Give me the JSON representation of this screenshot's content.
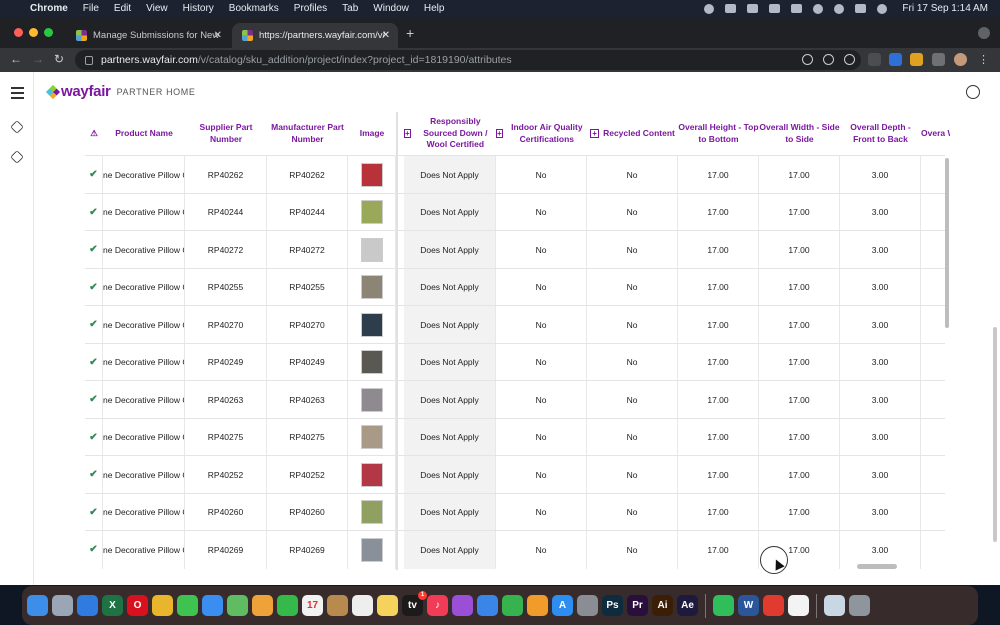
{
  "menubar": {
    "app": "Chrome",
    "items": [
      "File",
      "Edit",
      "View",
      "History",
      "Bookmarks",
      "Profiles",
      "Tab",
      "Window",
      "Help"
    ],
    "clock": "Fri 17 Sep  1:14 AM"
  },
  "browser": {
    "tabs": [
      {
        "title": "Manage Submissions for New"
      },
      {
        "title": "https://partners.wayfair.com/v/"
      }
    ],
    "url_host": "partners.wayfair.com",
    "url_path": "/v/catalog/sku_addition/project/index?project_id=1819190/attributes"
  },
  "app": {
    "brand": "wayfair",
    "brand_sub": "PARTNER HOME",
    "brand_color": "#7b189f"
  },
  "table": {
    "headers": {
      "status": "⚠",
      "product_name": "Product Name",
      "supplier_part": "Supplier Part Number",
      "manufacturer_part": "Manufacturer Part Number",
      "image": "Image",
      "responsibly_sourced": "Responsibly Sourced Down / Wool Certified",
      "indoor_air": "Indoor Air Quality Certifications",
      "recycled": "Recycled Content",
      "height": "Overall Height - Top to Bottom",
      "width": "Overall Width - Side to Side",
      "depth": "Overall Depth - Front to Back",
      "overall_cut": "Overa W"
    },
    "rows": [
      {
        "name": "ne Decorative Pillow C",
        "supplier": "RP40262",
        "manufacturer": "RP40262",
        "img": "#b8323a",
        "resp": "Does Not Apply",
        "air": "No",
        "recycled": "No",
        "height": "17.00",
        "width": "17.00",
        "depth": "3.00"
      },
      {
        "name": "ne Decorative Pillow C",
        "supplier": "RP40244",
        "manufacturer": "RP40244",
        "img": "#9aa85a",
        "resp": "Does Not Apply",
        "air": "No",
        "recycled": "No",
        "height": "17.00",
        "width": "17.00",
        "depth": "3.00"
      },
      {
        "name": "ne Decorative Pillow C",
        "supplier": "RP40272",
        "manufacturer": "RP40272",
        "img": "#c9c9c9",
        "resp": "Does Not Apply",
        "air": "No",
        "recycled": "No",
        "height": "17.00",
        "width": "17.00",
        "depth": "3.00"
      },
      {
        "name": "ne Decorative Pillow C",
        "supplier": "RP40255",
        "manufacturer": "RP40255",
        "img": "#8c8474",
        "resp": "Does Not Apply",
        "air": "No",
        "recycled": "No",
        "height": "17.00",
        "width": "17.00",
        "depth": "3.00"
      },
      {
        "name": "ne Decorative Pillow C",
        "supplier": "RP40270",
        "manufacturer": "RP40270",
        "img": "#2d3d4b",
        "resp": "Does Not Apply",
        "air": "No",
        "recycled": "No",
        "height": "17.00",
        "width": "17.00",
        "depth": "3.00"
      },
      {
        "name": "ne Decorative Pillow C",
        "supplier": "RP40249",
        "manufacturer": "RP40249",
        "img": "#5a5852",
        "resp": "Does Not Apply",
        "air": "No",
        "recycled": "No",
        "height": "17.00",
        "width": "17.00",
        "depth": "3.00"
      },
      {
        "name": "ne Decorative Pillow C",
        "supplier": "RP40263",
        "manufacturer": "RP40263",
        "img": "#8e8a8f",
        "resp": "Does Not Apply",
        "air": "No",
        "recycled": "No",
        "height": "17.00",
        "width": "17.00",
        "depth": "3.00"
      },
      {
        "name": "ne Decorative Pillow C",
        "supplier": "RP40275",
        "manufacturer": "RP40275",
        "img": "#a89a86",
        "resp": "Does Not Apply",
        "air": "No",
        "recycled": "No",
        "height": "17.00",
        "width": "17.00",
        "depth": "3.00"
      },
      {
        "name": "ne Decorative Pillow C",
        "supplier": "RP40252",
        "manufacturer": "RP40252",
        "img": "#b23845",
        "resp": "Does Not Apply",
        "air": "No",
        "recycled": "No",
        "height": "17.00",
        "width": "17.00",
        "depth": "3.00"
      },
      {
        "name": "ne Decorative Pillow C",
        "supplier": "RP40260",
        "manufacturer": "RP40260",
        "img": "#8fa060",
        "resp": "Does Not Apply",
        "air": "No",
        "recycled": "No",
        "height": "17.00",
        "width": "17.00",
        "depth": "3.00"
      },
      {
        "name": "ne Decorative Pillow C",
        "supplier": "RP40269",
        "manufacturer": "RP40269",
        "img": "#8a9099",
        "resp": "Does Not Apply",
        "air": "No",
        "recycled": "No",
        "height": "17.00",
        "width": "17.00",
        "depth": "3.00"
      }
    ]
  },
  "dock": {
    "apps": [
      {
        "name": "finder",
        "color": "#3d8ee8",
        "label": ""
      },
      {
        "name": "launchpad",
        "color": "#9aa5b5",
        "label": ""
      },
      {
        "name": "safari",
        "color": "#2f7be0",
        "label": ""
      },
      {
        "name": "excel",
        "color": "#1f7244",
        "label": "X"
      },
      {
        "name": "opera",
        "color": "#d9101d",
        "label": "O"
      },
      {
        "name": "chrome",
        "color": "#e9b52c",
        "label": ""
      },
      {
        "name": "messages",
        "color": "#3fc350",
        "label": ""
      },
      {
        "name": "mail",
        "color": "#3a8ef0",
        "label": ""
      },
      {
        "name": "maps",
        "color": "#5fbc61",
        "label": ""
      },
      {
        "name": "photos",
        "color": "#f0a23a",
        "label": ""
      },
      {
        "name": "facetime",
        "color": "#35b94a",
        "label": ""
      },
      {
        "name": "calendar",
        "color": "#f2f2f2",
        "label": "17"
      },
      {
        "name": "notes-brown",
        "color": "#b88a4e",
        "label": ""
      },
      {
        "name": "reminders",
        "color": "#eeeeee",
        "label": ""
      },
      {
        "name": "notes",
        "color": "#f5d25b",
        "label": ""
      },
      {
        "name": "tv",
        "color": "#1b1b1b",
        "label": "tv",
        "badge": "1"
      },
      {
        "name": "music",
        "color": "#f23c57",
        "label": "♪"
      },
      {
        "name": "podcasts",
        "color": "#9a4fd6",
        "label": ""
      },
      {
        "name": "keynote",
        "color": "#3a86e8",
        "label": ""
      },
      {
        "name": "numbers",
        "color": "#36b34e",
        "label": ""
      },
      {
        "name": "pages",
        "color": "#f09b2a",
        "label": ""
      },
      {
        "name": "app-store",
        "color": "#2d8ef0",
        "label": "A"
      },
      {
        "name": "system-preferences",
        "color": "#8a8d93",
        "label": ""
      },
      {
        "name": "photoshop",
        "color": "#0e2c3d",
        "label": "Ps"
      },
      {
        "name": "premiere",
        "color": "#2a0f3d",
        "label": "Pr"
      },
      {
        "name": "illustrator",
        "color": "#3a1e06",
        "label": "Ai"
      },
      {
        "name": "after-effects",
        "color": "#1e1a3d",
        "label": "Ae"
      },
      {
        "name": "whatsapp",
        "color": "#2fbe5a",
        "label": ""
      },
      {
        "name": "word",
        "color": "#2b579a",
        "label": "W"
      },
      {
        "name": "anydesk",
        "color": "#e13a2e",
        "label": ""
      },
      {
        "name": "textedit",
        "color": "#f3f3f3",
        "label": ""
      },
      {
        "name": "documents",
        "color": "#c9d6e4",
        "label": ""
      },
      {
        "name": "trash",
        "color": "#8f959c",
        "label": ""
      }
    ]
  }
}
